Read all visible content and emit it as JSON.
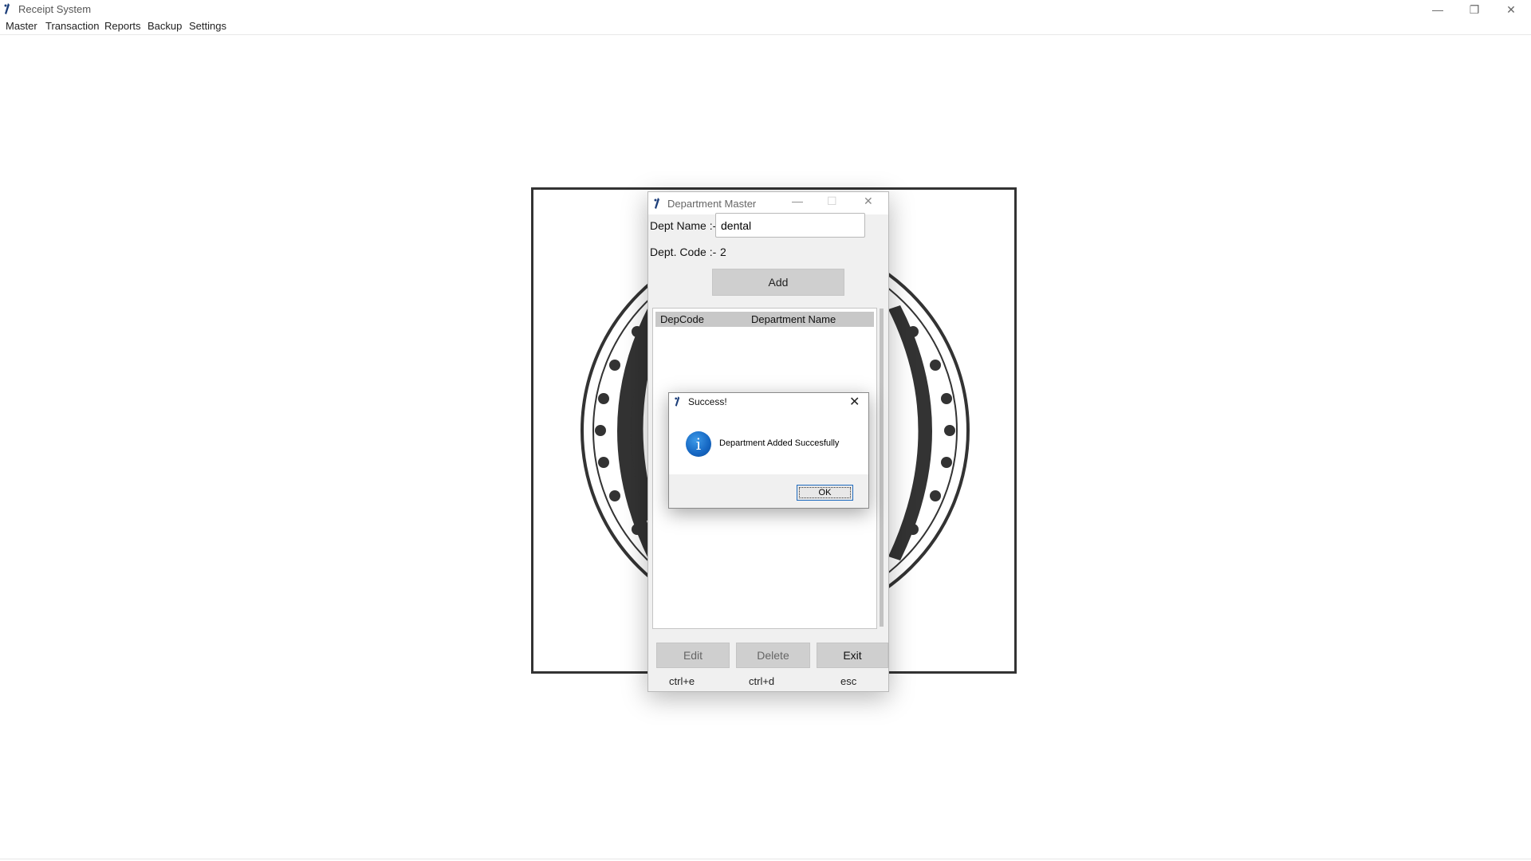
{
  "app": {
    "title": "Receipt System",
    "controls": {
      "minimize": "—",
      "restore": "❐",
      "close": "✕"
    }
  },
  "menu": [
    "Master",
    "Transaction",
    "Reports",
    "Backup",
    "Settings"
  ],
  "dept_master": {
    "title": "Department Master",
    "controls": {
      "minimize": "—",
      "maximize": "☐",
      "close": "✕"
    },
    "dept_name_label": "Dept Name :-",
    "dept_name_value": "dental",
    "dept_code_label": "Dept. Code :-",
    "dept_code_value": "2",
    "add_label": "Add",
    "table": {
      "columns": [
        "DepCode",
        "Department Name"
      ],
      "rows": []
    },
    "buttons": {
      "edit": {
        "label": "Edit",
        "shortcut": "ctrl+e"
      },
      "delete": {
        "label": "Delete",
        "shortcut": "ctrl+d"
      },
      "exit": {
        "label": "Exit",
        "shortcut": "esc"
      }
    }
  },
  "message_box": {
    "title": "Success!",
    "close": "✕",
    "icon": "info-icon",
    "icon_glyph": "i",
    "message": "Department Added Succesfully",
    "ok_label": "OK"
  },
  "colors": {
    "info_blue": "#1565c0",
    "focus_border": "#1f6bbf"
  }
}
